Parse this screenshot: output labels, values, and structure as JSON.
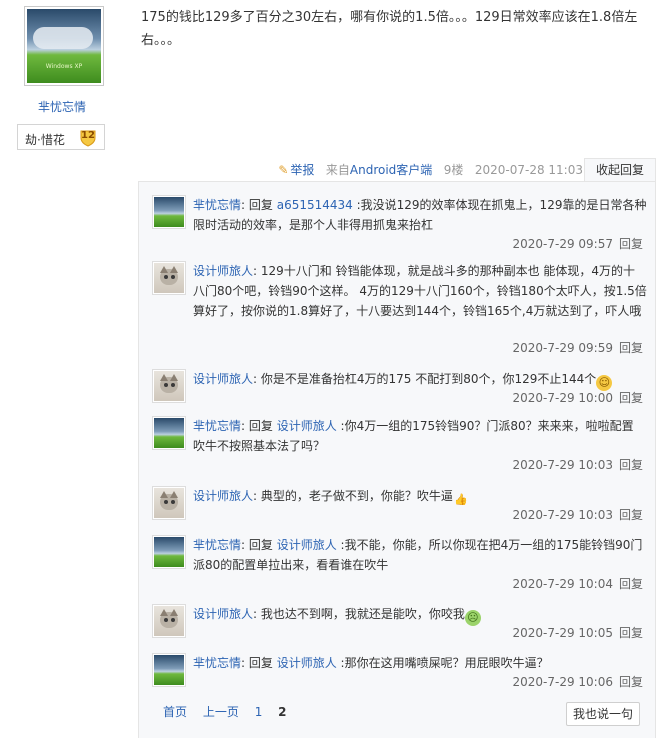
{
  "author": {
    "name": "芈忧忘情",
    "avatar_caption": "Windows XP",
    "badge_name": "劫·惜花",
    "badge_level": "12"
  },
  "post": {
    "text": "175的钱比129多了百分之30左右，哪有你说的1.5倍。。。129日常效率应该在1.8倍左右。。。",
    "report_label": "举报",
    "source_prefix": "来自",
    "source_client": "Android客户端",
    "floor": "9楼",
    "datetime": "2020-07-28 11:03",
    "collapse_label": "收起回复"
  },
  "reply_label": "回复",
  "replies": [
    {
      "user": "芈忧忘情",
      "avatar": "sky",
      "reply_to": "a651514434",
      "text": " :我没说129的效率体现在抓鬼上，129靠的是日常各种限时活动的效率，是那个人非得用抓鬼来抬杠",
      "time": "2020-7-29 09:57"
    },
    {
      "user": "设计师旅人",
      "avatar": "cat",
      "reply_to": "",
      "text": "129十八门和 铃铛能体现，就是战斗多的那种副本也 能体现，4万的十八门80个吧，铃铛90个这样。 4万的129十八门160个，铃铛180个太吓人，按1.5倍算好了，按你说的1.8算好了，十八要达到144个，铃铛165个,4万就达到了，吓人哦",
      "time": "2020-7-29 09:59"
    },
    {
      "user": "设计师旅人",
      "avatar": "cat",
      "reply_to": "",
      "text": "你是不是准备抬杠4万的175 不配打到80个，你129不止144个",
      "emoji": "smile",
      "time": "2020-7-29 10:00"
    },
    {
      "user": "芈忧忘情",
      "avatar": "sky",
      "reply_to": "设计师旅人",
      "text": " :你4万一组的175铃铛90？门派80？来来来，啦啦配置 吹牛不按照基本法了吗？",
      "time": "2020-7-29 10:03"
    },
    {
      "user": "设计师旅人",
      "avatar": "cat",
      "reply_to": "",
      "text": "典型的，老子做不到，你能？吹牛逼",
      "emoji": "thumb",
      "time": "2020-7-29 10:03"
    },
    {
      "user": "芈忧忘情",
      "avatar": "sky",
      "reply_to": "设计师旅人",
      "text": " :我不能，你能，所以你现在把4万一组的175能铃铛90门派80的配置单拉出来，看看谁在吹牛",
      "time": "2020-7-29 10:04"
    },
    {
      "user": "设计师旅人",
      "avatar": "cat",
      "reply_to": "",
      "text": "我也达不到啊，我就还是能吹，你咬我",
      "emoji": "sick",
      "time": "2020-7-29 10:05"
    },
    {
      "user": "芈忧忘情",
      "avatar": "sky",
      "reply_to": "设计师旅人",
      "text": " :那你在这用嘴喷屎呢？用屁眼吹牛逼？",
      "time": "2020-7-29 10:06"
    }
  ],
  "pager": {
    "first": "首页",
    "prev": "上一页",
    "p1": "1",
    "p2": "2"
  },
  "say_button": "我也说一句",
  "colors": {
    "link": "#2d64b3",
    "reply_bg": "#f7f8fa",
    "text": "#333333"
  }
}
